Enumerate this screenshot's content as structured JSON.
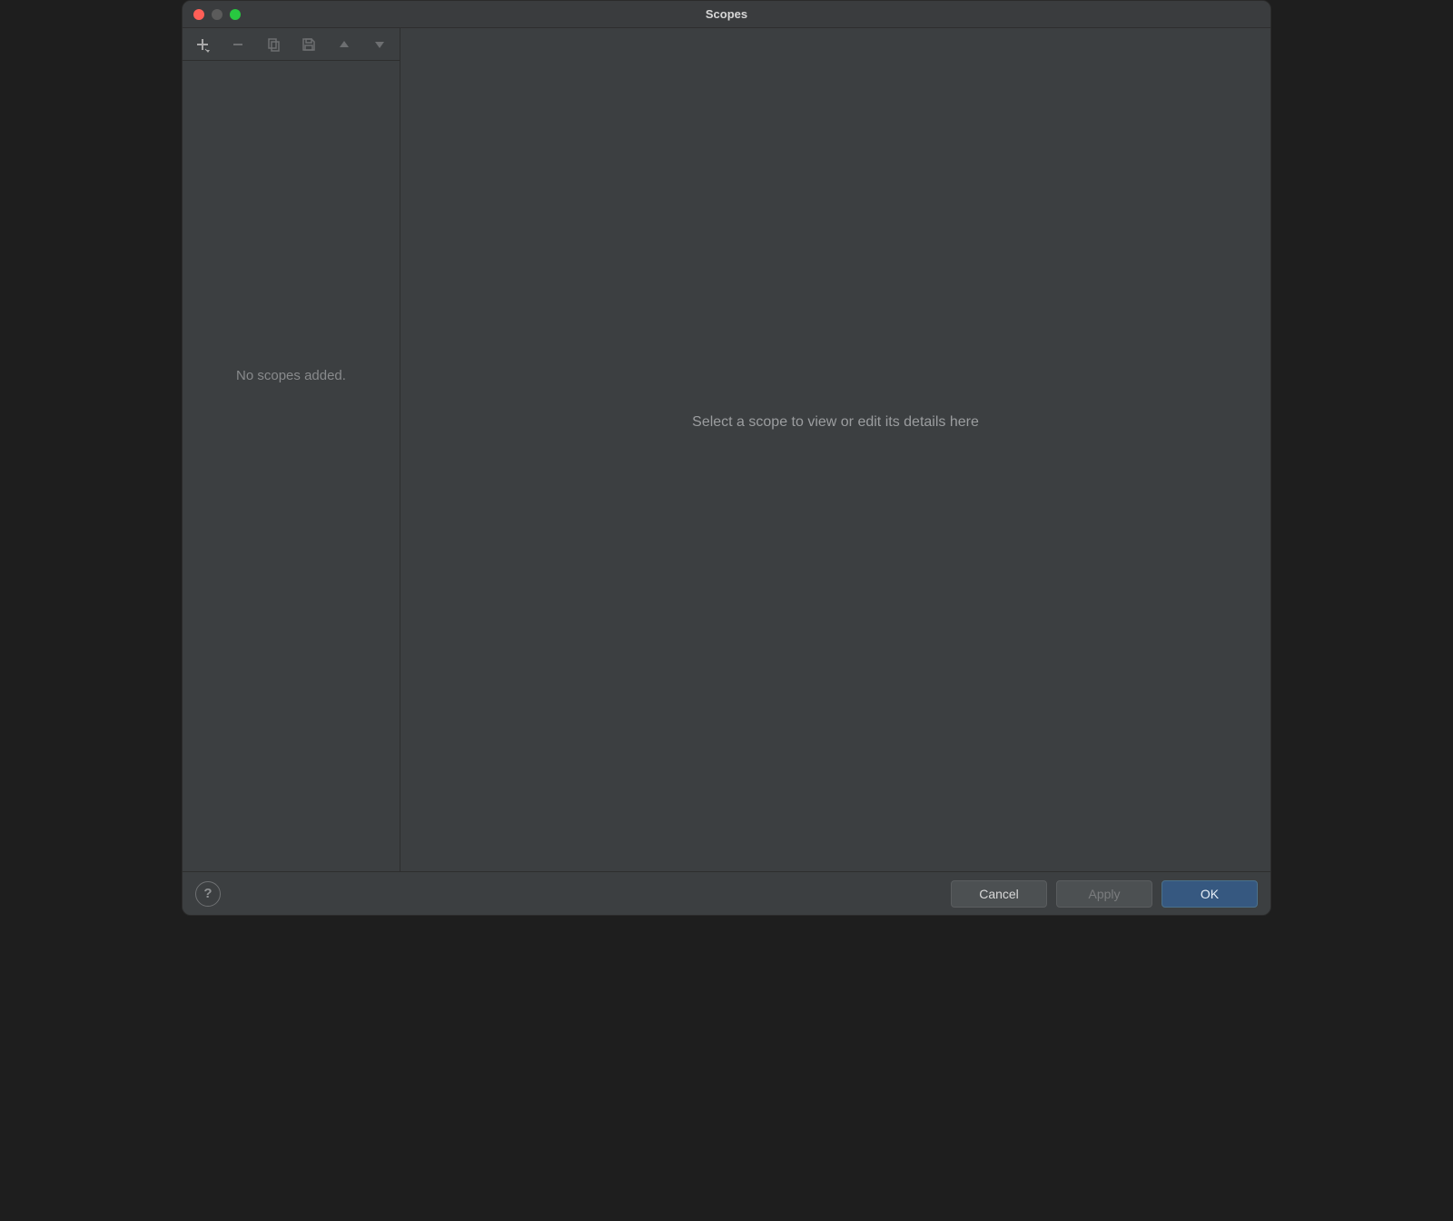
{
  "window": {
    "title": "Scopes"
  },
  "sidebar": {
    "empty_text": "No scopes added."
  },
  "main": {
    "placeholder": "Select a scope to view or edit its details here"
  },
  "footer": {
    "help_label": "?",
    "cancel_label": "Cancel",
    "apply_label": "Apply",
    "ok_label": "OK"
  }
}
